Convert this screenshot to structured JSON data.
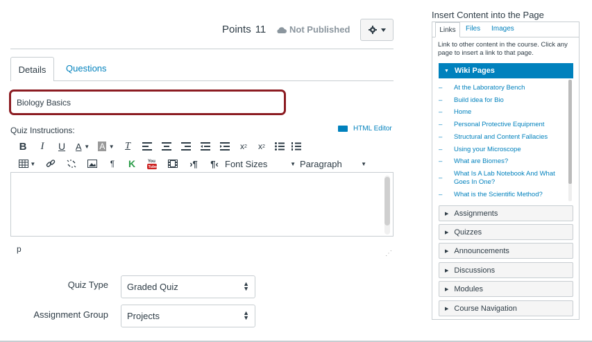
{
  "header": {
    "points_label": "Points",
    "points_value": "11",
    "publish_status": "Not Published",
    "settings_icon": "gear-icon"
  },
  "tabs": [
    {
      "label": "Details",
      "active": true
    },
    {
      "label": "Questions",
      "active": false
    }
  ],
  "title_field": {
    "value": "Biology Basics"
  },
  "instructions": {
    "label": "Quiz Instructions:",
    "html_editor_label": "HTML Editor",
    "font_sizes_label": "Font Sizes",
    "paragraph_label": "Paragraph",
    "path": "p"
  },
  "form": {
    "quiz_type": {
      "label": "Quiz Type",
      "value": "Graded Quiz"
    },
    "assignment_group": {
      "label": "Assignment Group",
      "value": "Projects"
    }
  },
  "sidebar": {
    "title": "Insert Content into the Page",
    "tabs": [
      "Links",
      "Files",
      "Images"
    ],
    "description": "Link to other content in the course. Click any page to insert a link to that page.",
    "wiki_header": "Wiki Pages",
    "wiki_pages": [
      "At the Laboratory Bench",
      "Build idea for Bio",
      "Home",
      "Personal Protective Equipment",
      "Structural and Content Fallacies",
      "Using your Microscope",
      "What are Biomes?",
      "What Is A Lab Notebook And What Goes In One?",
      "What is the Scientific Method?"
    ],
    "sections": [
      "Assignments",
      "Quizzes",
      "Announcements",
      "Discussions",
      "Modules",
      "Course Navigation"
    ]
  },
  "colors": {
    "link": "#0081bd",
    "focus_border": "#8c1c22",
    "border": "#c7cdd1",
    "text": "#2d3b45"
  }
}
